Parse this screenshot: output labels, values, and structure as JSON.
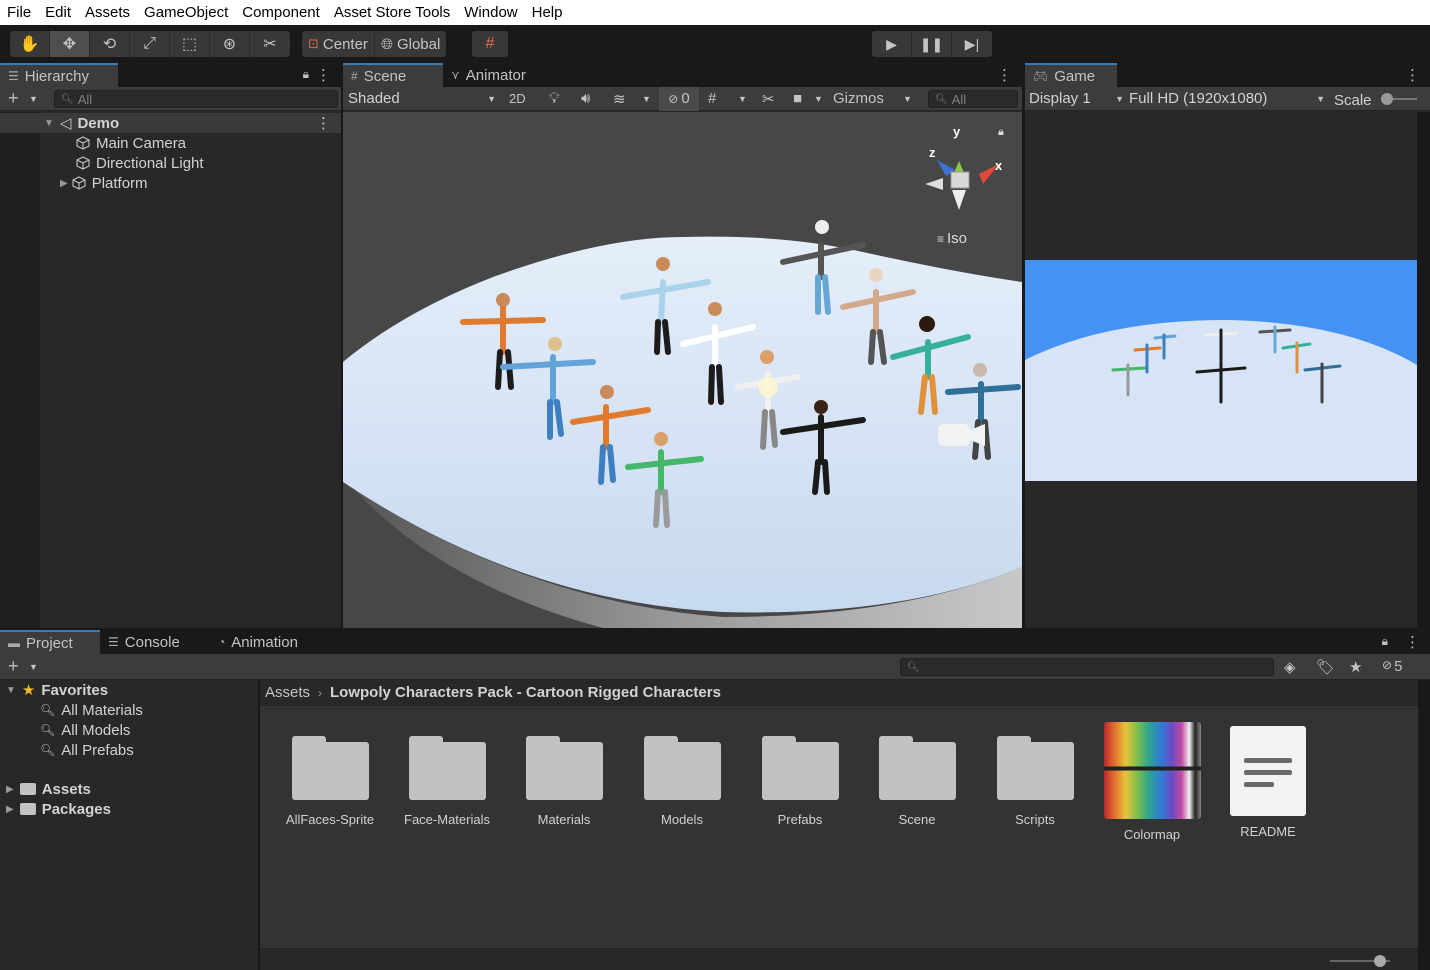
{
  "menu": [
    "File",
    "Edit",
    "Assets",
    "GameObject",
    "Component",
    "Asset Store Tools",
    "Window",
    "Help"
  ],
  "toolbar": {
    "pivot_label": "Center",
    "space_label": "Global"
  },
  "hierarchy": {
    "tab_label": "Hierarchy",
    "search_placeholder": "All",
    "scene_name": "Demo",
    "items": [
      "Main Camera",
      "Directional Light",
      "Platform"
    ]
  },
  "scene": {
    "tab_label": "Scene",
    "animator_tab_label": "Animator",
    "shading_mode": "Shaded",
    "mode_2d": "2D",
    "hidden_count": "0",
    "gizmos_label": "Gizmos",
    "search_placeholder": "All",
    "projection_label": "Iso",
    "axis_labels": {
      "x": "x",
      "y": "y",
      "z": "z"
    }
  },
  "game": {
    "tab_label": "Game",
    "display": "Display 1",
    "resolution": "Full HD (1920x1080)",
    "scale_label": "Scale"
  },
  "project": {
    "tabs": [
      "Project",
      "Console",
      "Animation"
    ],
    "hidden_count": "5",
    "favorites_label": "Favorites",
    "favorites": [
      "All Materials",
      "All Models",
      "All Prefabs"
    ],
    "roots": [
      "Assets",
      "Packages"
    ],
    "breadcrumb": [
      "Assets",
      "Lowpoly Characters Pack - Cartoon Rigged Characters"
    ],
    "assets": [
      {
        "name": "AllFaces-Sprite",
        "kind": "folder"
      },
      {
        "name": "Face-Materials",
        "kind": "folder"
      },
      {
        "name": "Materials",
        "kind": "folder"
      },
      {
        "name": "Models",
        "kind": "folder"
      },
      {
        "name": "Prefabs",
        "kind": "folder"
      },
      {
        "name": "Scene",
        "kind": "folder"
      },
      {
        "name": "Scripts",
        "kind": "folder"
      },
      {
        "name": "Colormap",
        "kind": "texture"
      },
      {
        "name": "README",
        "kind": "text"
      }
    ]
  },
  "colors": {
    "editor_bg": "#282828",
    "tab_active_accent": "#3a79bb",
    "sky_blue": "#4592f5",
    "platform": "#d6e4f5"
  }
}
